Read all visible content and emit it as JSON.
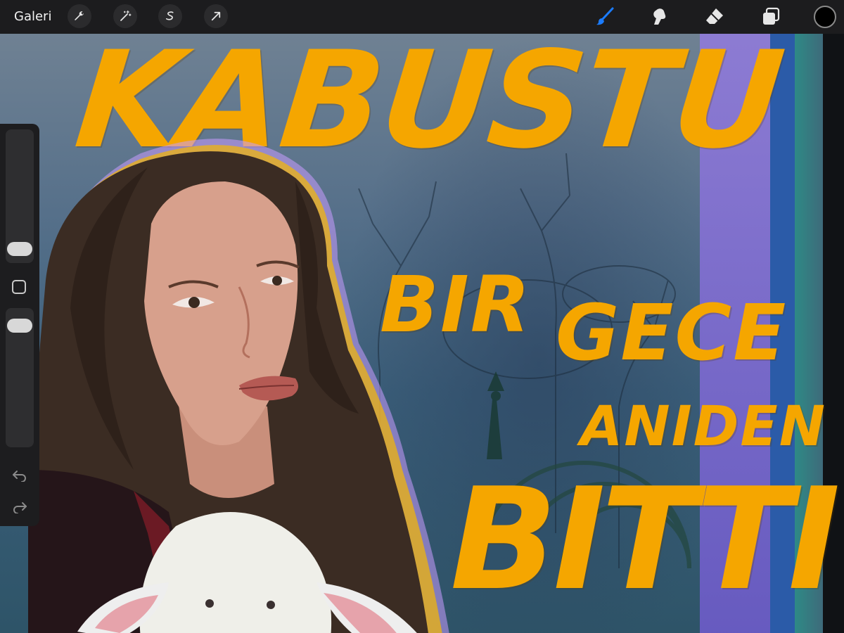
{
  "topbar": {
    "gallery_label": "Galeri",
    "left_tools": [
      "wrench-icon",
      "magic-wand-icon",
      "selection-icon",
      "transform-arrow-icon"
    ],
    "right_tools": [
      "brush-icon",
      "smudge-icon",
      "eraser-icon",
      "layers-icon"
    ],
    "active_tool": "brush-icon",
    "current_color": "#000000"
  },
  "canvas": {
    "poster_text": {
      "line1": "KABUSTU",
      "line2a": "BIR",
      "line2b": "GECE",
      "line3": "ANIDEN",
      "line4": "BITTI"
    },
    "accent_color": "#f5a600"
  },
  "sidebar": {
    "tools": [
      "brush-size-slider",
      "modify-button",
      "opacity-slider",
      "undo-icon",
      "redo-icon"
    ]
  }
}
